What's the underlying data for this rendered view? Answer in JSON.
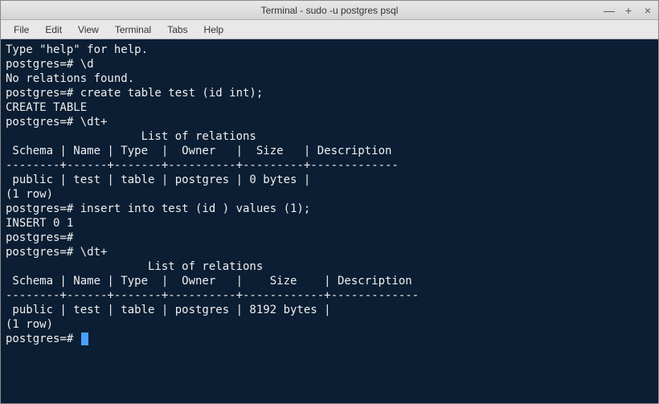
{
  "window": {
    "title": "Terminal - sudo -u postgres psql"
  },
  "menu": {
    "file": "File",
    "edit": "Edit",
    "view": "View",
    "terminal": "Terminal",
    "tabs": "Tabs",
    "help": "Help"
  },
  "terminal": {
    "lines": [
      "Type \"help\" for help.",
      "",
      "postgres=# \\d",
      "No relations found.",
      "postgres=# create table test (id int);",
      "CREATE TABLE",
      "postgres=# \\dt+",
      "                    List of relations",
      " Schema | Name | Type  |  Owner   |  Size   | Description ",
      "--------+------+-------+----------+---------+-------------",
      " public | test | table | postgres | 0 bytes | ",
      "(1 row)",
      "",
      "postgres=# insert into test (id ) values (1);",
      "INSERT 0 1",
      "postgres=# ",
      "postgres=# \\dt+",
      "                     List of relations",
      " Schema | Name | Type  |  Owner   |    Size    | Description ",
      "--------+------+-------+----------+------------+-------------",
      " public | test | table | postgres | 8192 bytes | ",
      "(1 row)",
      "",
      "postgres=# "
    ]
  },
  "chart_data": {
    "type": "table",
    "title": "List of relations (\\dt+ after insert)",
    "columns": [
      "Schema",
      "Name",
      "Type",
      "Owner",
      "Size",
      "Description"
    ],
    "rows": [
      [
        "public",
        "test",
        "table",
        "postgres",
        "8192 bytes",
        ""
      ]
    ]
  }
}
